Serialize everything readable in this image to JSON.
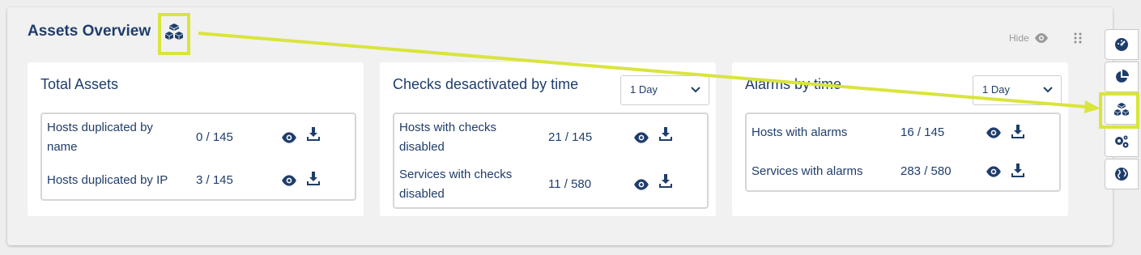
{
  "header": {
    "title": "Assets Overview",
    "hide_label": "Hide"
  },
  "cards": [
    {
      "title": "Total Assets",
      "rows": [
        {
          "label": "Hosts duplicated by name",
          "value": "0 / 145"
        },
        {
          "label": "Hosts duplicated by IP",
          "value": "3 / 145"
        }
      ]
    },
    {
      "title": "Checks desactivated by time",
      "select": "1 Day",
      "rows": [
        {
          "label": "Hosts with checks disabled",
          "value": "21 / 145"
        },
        {
          "label": "Services with checks disabled",
          "value": "11 / 580"
        }
      ]
    },
    {
      "title": "Alarms by time",
      "select": "1 Day",
      "rows": [
        {
          "label": "Hosts with alarms",
          "value": "16 / 145"
        },
        {
          "label": "Services with alarms",
          "value": "283 / 580"
        }
      ]
    }
  ],
  "sidebar": {
    "icons": [
      "dashboard-icon",
      "pie-chart-icon",
      "cubes-icon",
      "gears-icon",
      "globe-icon"
    ]
  },
  "colors": {
    "primary": "#1f3d6b",
    "highlight": "#d9e53a",
    "background": "#f1f1f1"
  }
}
